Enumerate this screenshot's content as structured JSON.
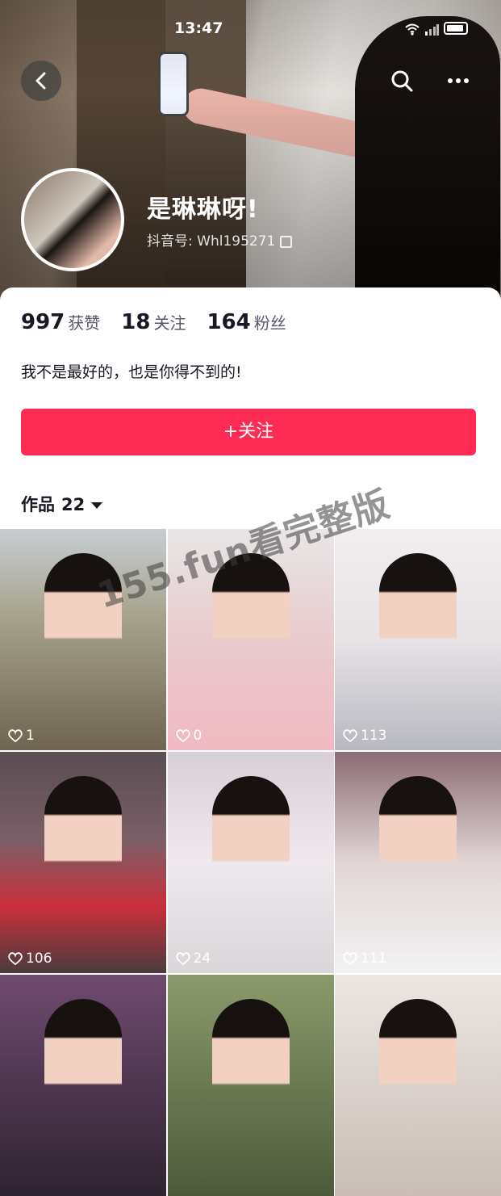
{
  "status_bar": {
    "time": "13:47"
  },
  "profile": {
    "name": "是琳琳呀!",
    "account_label": "抖音号: Whl195271",
    "stats": [
      {
        "value": "997",
        "label": "获赞"
      },
      {
        "value": "18",
        "label": "关注"
      },
      {
        "value": "164",
        "label": "粉丝"
      }
    ],
    "bio": "我不是最好的，也是你得不到的!",
    "follow_label": "+关注"
  },
  "works_tab": {
    "label": "作品",
    "count": "22"
  },
  "videos": [
    {
      "likes": "1"
    },
    {
      "likes": "0"
    },
    {
      "likes": "113"
    },
    {
      "likes": "106"
    },
    {
      "likes": "24"
    },
    {
      "likes": "111"
    },
    {
      "likes": ""
    },
    {
      "likes": ""
    },
    {
      "likes": ""
    }
  ],
  "watermark": "155.fun看完整版",
  "icons": [
    "back-arrow-icon",
    "search-icon",
    "more-icon",
    "copy-icon",
    "heart-icon",
    "caret-down-icon",
    "wifi-icon",
    "signal-icon",
    "battery-icon"
  ],
  "colors": {
    "accent": "#fe2c55",
    "text_primary": "#161823",
    "text_secondary": "#57596a"
  }
}
